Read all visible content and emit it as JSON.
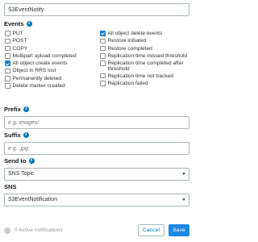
{
  "name_field": {
    "value": "S3EventNotify"
  },
  "events": {
    "label": "Events",
    "left": [
      {
        "label": "PUT",
        "checked": false
      },
      {
        "label": "POST",
        "checked": false
      },
      {
        "label": "COPY",
        "checked": false
      },
      {
        "label": "Multipart upload completed",
        "checked": false
      },
      {
        "label": "All object create events",
        "checked": true
      },
      {
        "label": "Object in RRS lost",
        "checked": false
      },
      {
        "label": "Permanently deleted",
        "checked": false
      },
      {
        "label": "Delete marker created",
        "checked": false
      }
    ],
    "right": [
      {
        "label": "All object delete events",
        "checked": true
      },
      {
        "label": "Restore initiated",
        "checked": false
      },
      {
        "label": "Restore completed",
        "checked": false
      },
      {
        "label": "Replication time missed threshold",
        "checked": false
      },
      {
        "label": "Replication time completed after threshold",
        "checked": false
      },
      {
        "label": "Replication time not tracked",
        "checked": false
      },
      {
        "label": "Replication failed",
        "checked": false
      }
    ]
  },
  "prefix": {
    "label": "Prefix",
    "placeholder": "e.g. images/"
  },
  "suffix": {
    "label": "Suffix",
    "placeholder": "e.g. .jpg"
  },
  "send_to": {
    "label": "Send to",
    "value": "SNS Topic"
  },
  "sns": {
    "label": "SNS",
    "value": "S3EventNotification"
  },
  "footer": {
    "active_notifications": "0 Active notifications",
    "cancel_label": "Cancel",
    "save_label": "Save"
  },
  "colors": {
    "accent": "#1e88e5",
    "checkbox_on": "#1a7bc4",
    "link": "#0073bb"
  }
}
